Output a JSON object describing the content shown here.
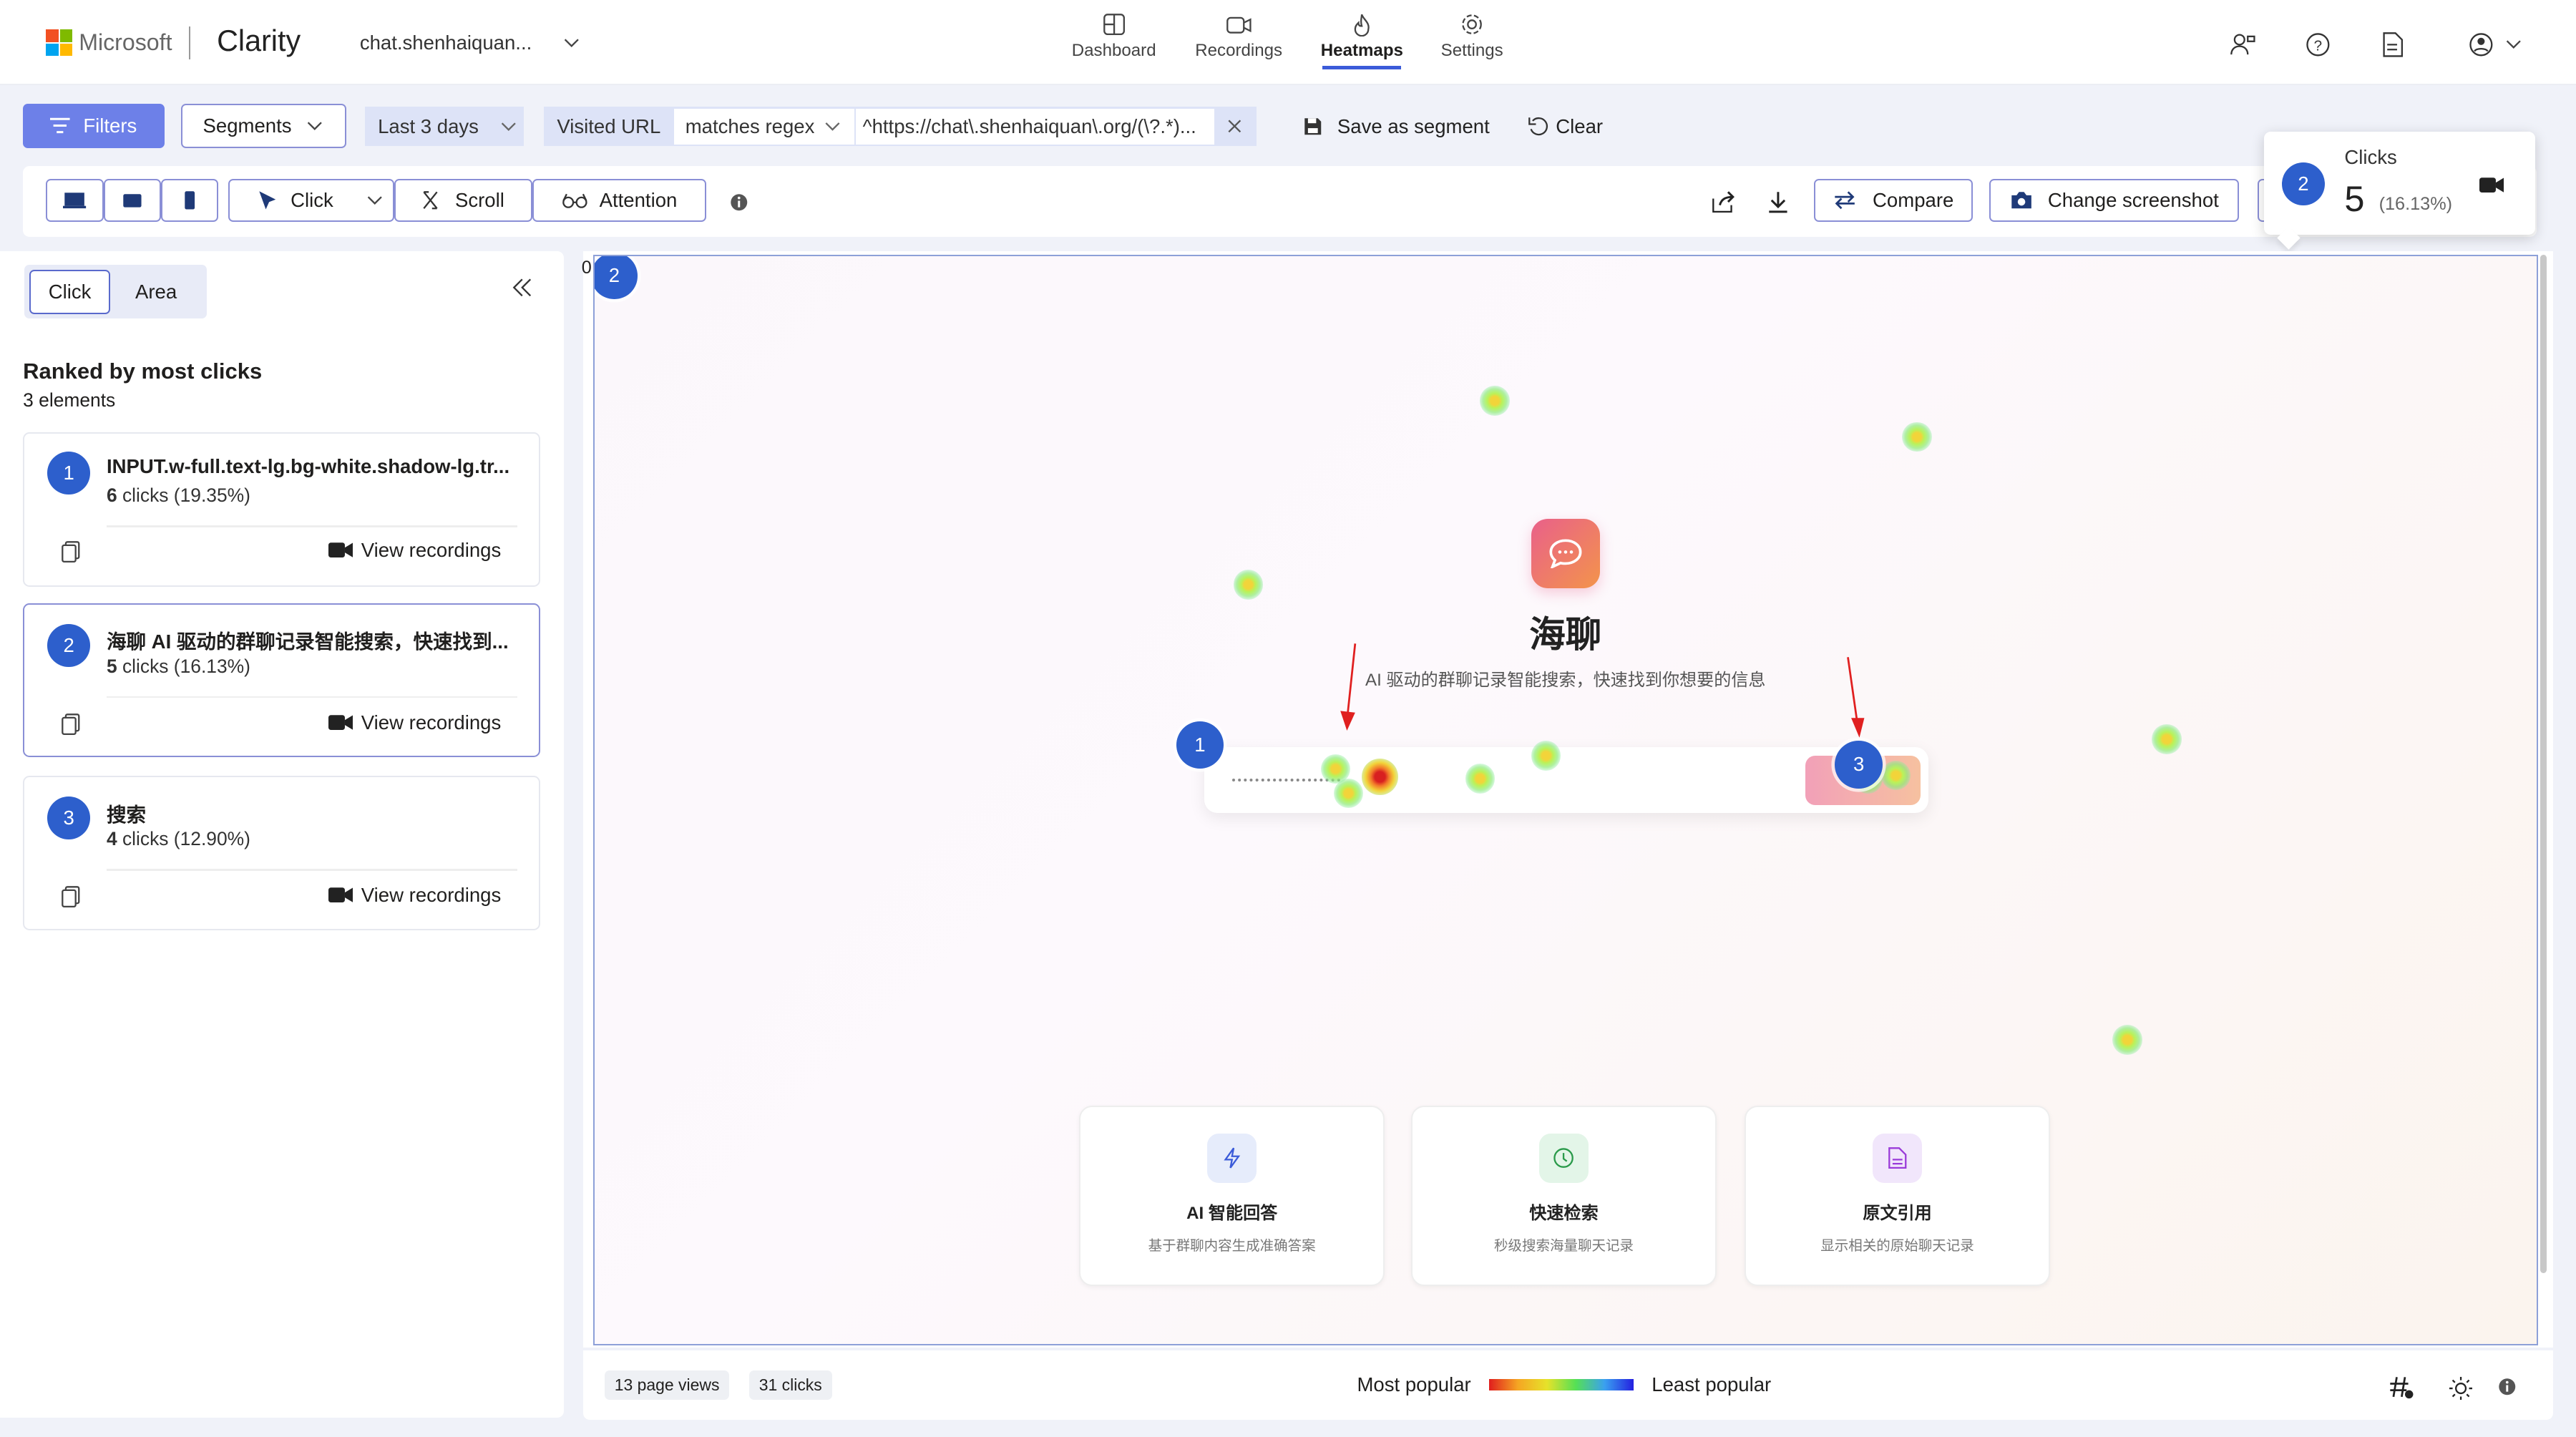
{
  "brand": {
    "company": "Microsoft",
    "product": "Clarity",
    "project": "chat.shenhaiquan..."
  },
  "nav": [
    {
      "label": "Dashboard",
      "icon": "dashboard-icon"
    },
    {
      "label": "Recordings",
      "icon": "video-icon"
    },
    {
      "label": "Heatmaps",
      "icon": "flame-icon"
    },
    {
      "label": "Settings",
      "icon": "gear-icon"
    }
  ],
  "filters": {
    "filters_label": "Filters",
    "segments_label": "Segments",
    "date_label": "Last 3 days",
    "url_label": "Visited URL",
    "operator": "matches regex",
    "pattern": "^https://chat\\.shenhaiquan\\.org/(\\?.*)...",
    "save_label": "Save as segment",
    "clear_label": "Clear"
  },
  "heat_toolbar": {
    "click": "Click",
    "scroll": "Scroll",
    "attention": "Attention",
    "compare": "Compare",
    "change_screenshot": "Change screenshot"
  },
  "tooltip": {
    "rank": "2",
    "label": "Clicks",
    "value": "5",
    "percent": "(16.13%)"
  },
  "panel": {
    "tab_click": "Click",
    "tab_area": "Area",
    "heading": "Ranked by most clicks",
    "subheading": "3 elements",
    "view_recordings": "View recordings",
    "items": [
      {
        "rank": "1",
        "title": "INPUT.w-full.text-lg.bg-white.shadow-lg.tr...",
        "count": "6",
        "percent": "clicks (19.35%)"
      },
      {
        "rank": "2",
        "title": "海聊 AI 驱动的群聊记录智能搜索，快速找到...",
        "count": "5",
        "percent": "clicks (16.13%)"
      },
      {
        "rank": "3",
        "title": "搜索",
        "count": "4",
        "percent": "clicks (12.90%)"
      }
    ]
  },
  "canvas": {
    "corner_label": "0",
    "marker_top": "2",
    "marker_input": "1",
    "marker_button": "3",
    "app_title": "海聊",
    "app_subtitle": "AI 驱动的群聊记录智能搜索，快速找到你想要的信息",
    "features": [
      {
        "title": "AI 智能回答",
        "desc": "基于群聊内容生成准确答案",
        "icon": "bolt-icon"
      },
      {
        "title": "快速检索",
        "desc": "秒级搜索海量聊天记录",
        "icon": "clock-icon"
      },
      {
        "title": "原文引用",
        "desc": "显示相关的原始聊天记录",
        "icon": "document-icon"
      }
    ]
  },
  "footer": {
    "page_views": "13 page views",
    "clicks": "31 clicks",
    "most": "Most popular",
    "least": "Least popular"
  },
  "colors": {
    "accent": "#3b5bd9",
    "marker": "#2d5fcc",
    "filter_btn": "#6d80e8"
  }
}
